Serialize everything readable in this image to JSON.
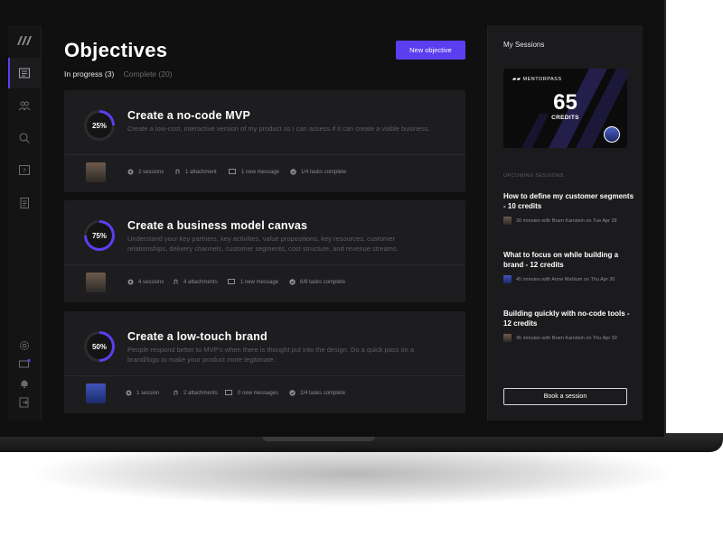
{
  "page": {
    "title": "Objectives",
    "new_button": "New objective",
    "tabs": [
      {
        "label": "In progress (3)",
        "active": true
      },
      {
        "label": "Complete (20)",
        "active": false
      }
    ]
  },
  "objectives": [
    {
      "progress": "25%",
      "progress_value": 0.25,
      "title": "Create a no-code MVP",
      "description": "Create a low-cost, interactive version of my product so I can assess if it can create a viable business.",
      "sessions": "2 sessions",
      "attachments": "1 attachment",
      "messages": "1 new message",
      "tasks": "1/4 tasks complete"
    },
    {
      "progress": "75%",
      "progress_value": 0.75,
      "title": "Create a business model canvas",
      "description": "Understand your key partners, key activities, value propositions, key resources, customer relationships, delivery channels, customer segments, cost structure, and revenue streams.",
      "sessions": "4 sessions",
      "attachments": "4 attachments",
      "messages": "1 new message",
      "tasks": "6/8 tasks complete"
    },
    {
      "progress": "50%",
      "progress_value": 0.5,
      "title": "Create a low-touch brand",
      "description": "People respond better to MVP's when there is thought put into the design. Do a quick pass on a brand/logo to make your product more legitimate.",
      "sessions": "1 session",
      "attachments": "2 attachments",
      "messages": "0 new messages",
      "tasks": "2/4 tasks complete"
    }
  ],
  "sidebar": {
    "title": "My Sessions",
    "card": {
      "brand": "MENTORPASS",
      "credits": "65",
      "credits_label": "CREDITS"
    },
    "upcoming_label": "UPCOMING SESSIONS",
    "sessions": [
      {
        "title": "How to define my customer segments - 10 credits",
        "meta": "30 minutes with Bram Kanstein on Tue Apr 28"
      },
      {
        "title": "What to focus on while building a brand - 12 credits",
        "meta": "45 minutes with Anne Mahlum on Thu Apr 30"
      },
      {
        "title": "Building quickly with no-code tools - 12 credits",
        "meta": "45 minutes with Bram Kanstein on Thu Apr 30"
      }
    ],
    "book_button": "Book a session"
  },
  "nav": {
    "icons": [
      "logo-icon",
      "objectives-icon",
      "users-icon",
      "search-icon",
      "help-icon",
      "documents-icon",
      "settings-icon",
      "messages-icon",
      "bell-icon",
      "logout-icon"
    ]
  },
  "colors": {
    "accent": "#5b3ef0",
    "background": "#101011",
    "card": "#1d1d1f",
    "panel": "#1b1b1d"
  }
}
